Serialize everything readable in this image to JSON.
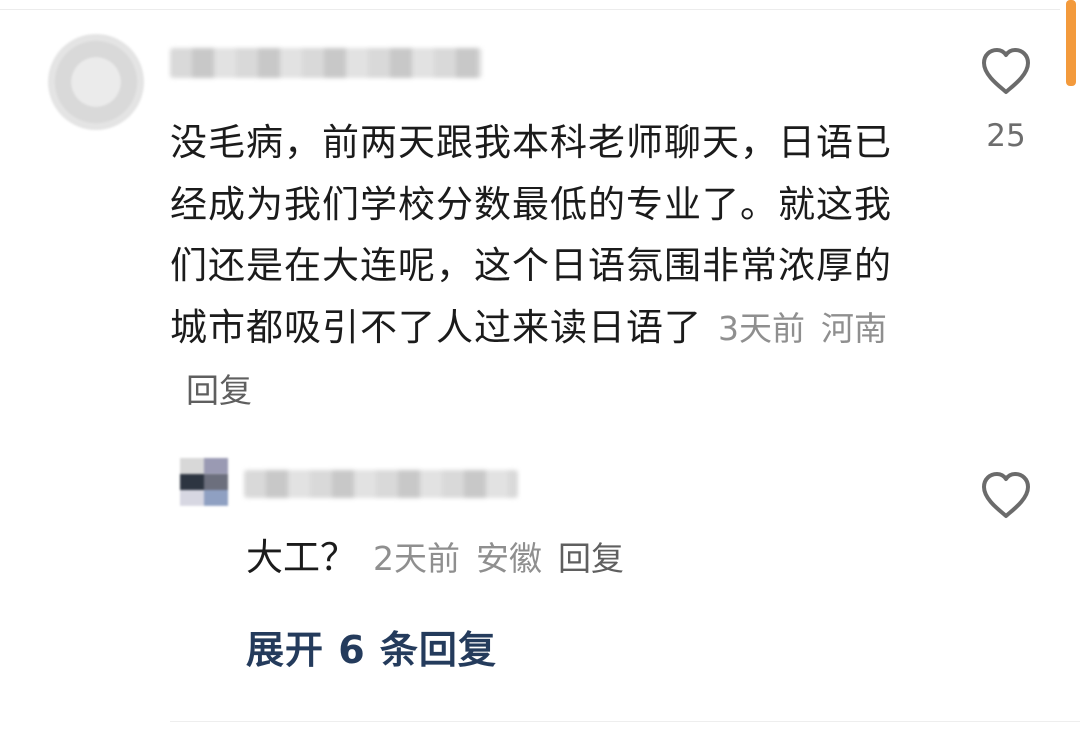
{
  "comment": {
    "body": "没毛病，前两天跟我本科老师聊天，日语已经成为我们学校分数最低的专业了。就这我们还是在大连呢，这个日语氛围非常浓厚的城市都吸引不了人过来读日语了",
    "time": "3天前",
    "location": "河南",
    "reply_label": "回复",
    "like_count": "25",
    "like_icon": "heart-outline-icon"
  },
  "reply": {
    "body": "大工？",
    "time": "2天前",
    "location": "安徽",
    "reply_label": "回复",
    "like_icon": "heart-outline-icon"
  },
  "expand_replies": "展开 6 条回复",
  "colors": {
    "accent_scrollbar": "#f39a3c",
    "expand_link": "#243b5c",
    "meta_text": "#8f8f8f"
  }
}
